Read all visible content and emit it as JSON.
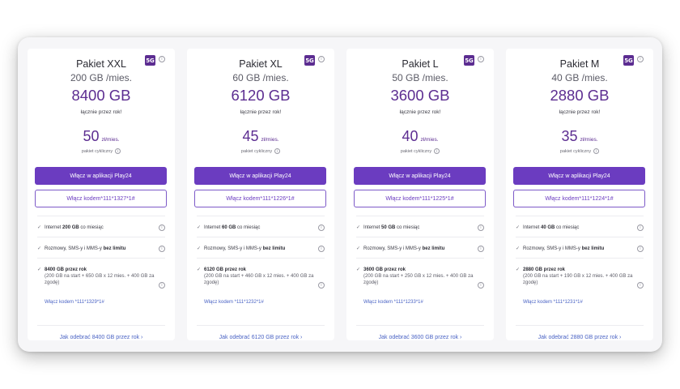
{
  "badge_label": "5G",
  "info_glyph": "i",
  "check_glyph": "✓",
  "colors": {
    "brand_purple": "#5c2d91",
    "button_purple": "#6b3cc0",
    "link_blue": "#4a63c4"
  },
  "plans": [
    {
      "name": "Pakiet XXL",
      "per_month": "200 GB /mies.",
      "total": "8400 GB",
      "total_note": "łącznie przez rok!",
      "price": "50",
      "price_unit": "zł/mies.",
      "cycle_label": "pakiet cykliczny",
      "activate_app": "Włącz w aplikacji Play24",
      "activate_code_prefix": "Włącz kodem ",
      "activate_code": "*111*1327*1#",
      "f1_pre": "Internet ",
      "f1_bold": "200 GB",
      "f1_post": " co miesiąc",
      "f2_pre": "Rozmowy, SMS-y i MMS-y ",
      "f2_bold": "bez limitu",
      "f3_bold": "8400 GB przez rok",
      "f3_sub": "(200 GB na start + 650 GB x 12 mies. + 400 GB za zgodę)",
      "code_link": "Włącz kodem *111*1329*1#",
      "howto": "Jak odebrać 8400 GB przez rok ›"
    },
    {
      "name": "Pakiet XL",
      "per_month": "60 GB /mies.",
      "total": "6120 GB",
      "total_note": "łącznie przez rok!",
      "price": "45",
      "price_unit": "zł/mies.",
      "cycle_label": "pakiet cykliczny",
      "activate_app": "Włącz w aplikacji Play24",
      "activate_code_prefix": "Włącz kodem ",
      "activate_code": "*111*1226*1#",
      "f1_pre": "Internet ",
      "f1_bold": "60 GB",
      "f1_post": " co miesiąc",
      "f2_pre": "Rozmowy, SMS-y i MMS-y ",
      "f2_bold": "bez limitu",
      "f3_bold": "6120 GB przez rok",
      "f3_sub": "(200 GB na start + 460 GB x 12 mies. + 400 GB za zgodę)",
      "code_link": "Włącz kodem *111*1232*1#",
      "howto": "Jak odebrać 6120 GB przez rok ›"
    },
    {
      "name": "Pakiet L",
      "per_month": "50 GB /mies.",
      "total": "3600 GB",
      "total_note": "łącznie przez rok!",
      "price": "40",
      "price_unit": "zł/mies.",
      "cycle_label": "pakiet cykliczny",
      "activate_app": "Włącz w aplikacji Play24",
      "activate_code_prefix": "Włącz kodem ",
      "activate_code": "*111*1225*1#",
      "f1_pre": "Internet ",
      "f1_bold": "50 GB",
      "f1_post": " co miesiąc",
      "f2_pre": "Rozmowy, SMS-y i MMS-y ",
      "f2_bold": "bez limitu",
      "f3_bold": "3600 GB przez rok",
      "f3_sub": "(200 GB na start + 250 GB x 12 mies. + 400 GB za zgodę)",
      "code_link": "Włącz kodem *111*1233*1#",
      "howto": "Jak odebrać 3600 GB przez rok ›"
    },
    {
      "name": "Pakiet M",
      "per_month": "40 GB /mies.",
      "total": "2880 GB",
      "total_note": "łącznie przez rok!",
      "price": "35",
      "price_unit": "zł/mies.",
      "cycle_label": "pakiet cykliczny",
      "activate_app": "Włącz w aplikacji Play24",
      "activate_code_prefix": "Włącz kodem ",
      "activate_code": "*111*1224*1#",
      "f1_pre": "Internet ",
      "f1_bold": "40 GB",
      "f1_post": " co miesiąc",
      "f2_pre": "Rozmowy, SMS-y i MMS-y ",
      "f2_bold": "bez limitu",
      "f3_bold": "2880 GB przez rok",
      "f3_sub": "(200 GB na start + 190 GB x 12 mies. + 400 GB za zgodę)",
      "code_link": "Włącz kodem *111*1231*1#",
      "howto": "Jak odebrać 2880 GB przez rok ›"
    }
  ]
}
